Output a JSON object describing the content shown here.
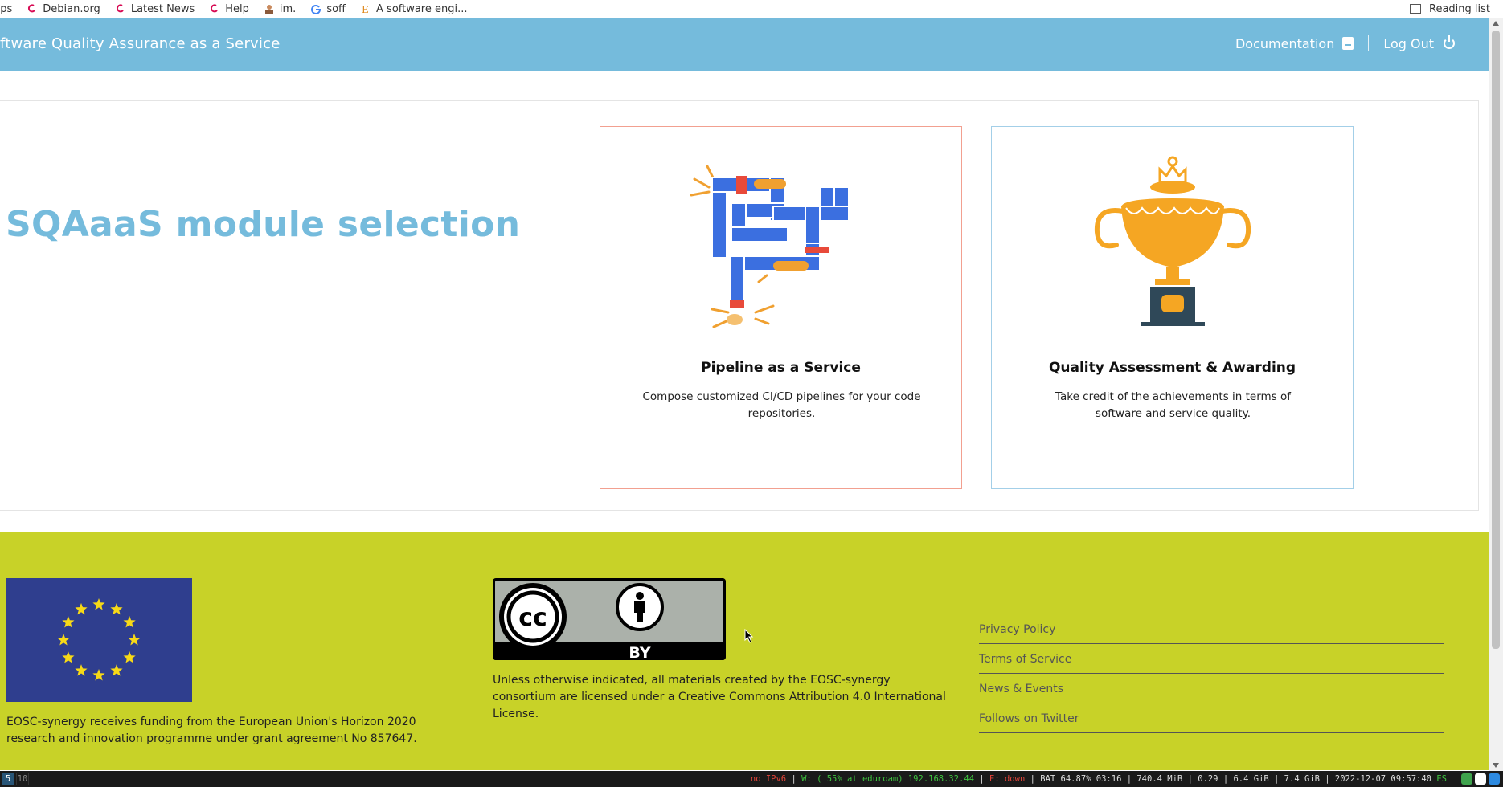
{
  "browser": {
    "bookmarks": [
      {
        "label": "pps",
        "icon": "apps-grid-icon"
      },
      {
        "label": "Debian.org",
        "icon": "debian-swirl-icon"
      },
      {
        "label": "Latest News",
        "icon": "debian-swirl-icon"
      },
      {
        "label": "Help",
        "icon": "debian-swirl-icon"
      },
      {
        "label": "im.",
        "icon": "avatar-icon"
      },
      {
        "label": "soff",
        "icon": "google-icon"
      },
      {
        "label": "A software engi...",
        "icon": "bookmark-e-icon"
      }
    ],
    "reading_list": "Reading list"
  },
  "header": {
    "title": "ftware Quality Assurance as a Service",
    "nav": {
      "documentation": "Documentation",
      "logout": "Log Out"
    }
  },
  "main": {
    "heading": "SQAaaS module selection",
    "cards": [
      {
        "title": "Pipeline as a Service",
        "description": "Compose customized CI/CD pipelines for your code repositories.",
        "icon": "pipeline-illustration-icon"
      },
      {
        "title": "Quality Assessment & Awarding",
        "description": "Take credit of the achievements in terms of software and service quality.",
        "icon": "trophy-illustration-icon"
      }
    ]
  },
  "footer": {
    "funding_text": "EOSC-synergy receives funding from the European Union's Horizon 2020 research and innovation programme under grant agreement No 857647.",
    "license_text": "Unless otherwise indicated, all materials created by the EOSC-synergy consortium are licensed under a Creative Commons Attribution 4.0 International License.",
    "cc_label": "BY",
    "links": [
      "Privacy Policy",
      "Terms of Service",
      "News & Events",
      "Follows on Twitter"
    ]
  },
  "statusbar": {
    "workspaces": [
      "5",
      "10"
    ],
    "ipv6": "no IPv6",
    "wireless": "W: ( 55% at eduroam) 192.168.32.44",
    "ethernet": "E: down",
    "system": "BAT 64.87% 03:16 | 740.4 MiB | 0.29 | 6.4 GiB | 7.4 GiB | 2022-12-07 09:57:40",
    "locale": "ES"
  },
  "colors": {
    "accent": "#75bbdc",
    "footer_bg": "#c8d228",
    "pipeline_border": "#f2a090",
    "quality_border": "#a3cfe8"
  }
}
